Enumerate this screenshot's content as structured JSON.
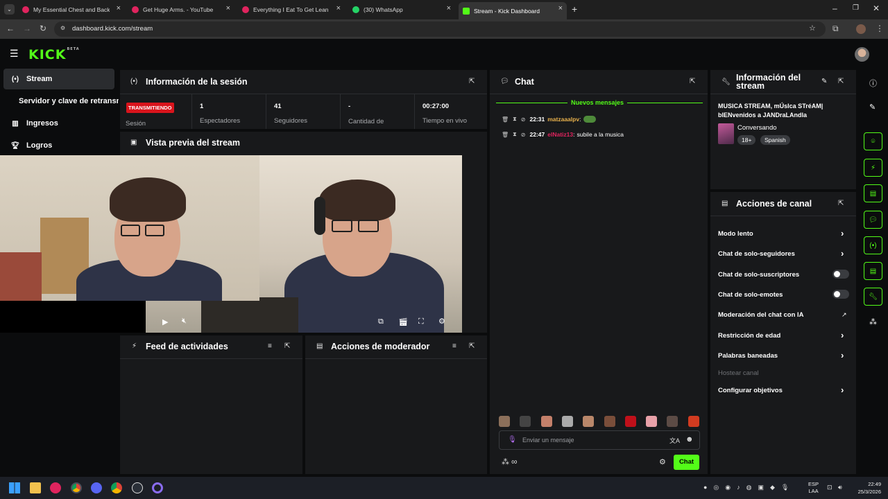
{
  "browser": {
    "tabs": [
      {
        "title": "My Essential Chest and Back W",
        "color": "#e0245e"
      },
      {
        "title": "Get Huge Arms. - YouTube",
        "color": "#e0245e"
      },
      {
        "title": "Everything I Eat To Get Lean In",
        "color": "#e0245e"
      },
      {
        "title": "(30) WhatsApp",
        "color": "#25d366"
      },
      {
        "title": "Stream - Kick Dashboard",
        "color": "#53fc18"
      }
    ],
    "url": "dashboard.kick.com/stream",
    "new_tab": "+"
  },
  "app": {
    "logo": "KICK",
    "logo_badge": "BETA"
  },
  "sidebar": {
    "items": [
      {
        "label": "Stream",
        "icon": "broadcast-icon"
      },
      {
        "label": "Servidor y clave de retransmisión",
        "icon": "key-icon"
      },
      {
        "label": "Ingresos",
        "icon": "chart-icon"
      },
      {
        "label": "Logros",
        "icon": "trophy-icon"
      }
    ]
  },
  "session": {
    "title": "Información de la sesión",
    "status_badge": "TRANSMITIENDO",
    "status_label": "Sesión",
    "stats": [
      {
        "value": "1",
        "label": "Espectadores"
      },
      {
        "value": "41",
        "label": "Seguidores"
      },
      {
        "value": "-",
        "label": "Cantidad de suscripciones"
      },
      {
        "value": "00:27:00",
        "label": "Tiempo en vivo"
      }
    ]
  },
  "preview": {
    "title": "Vista previa del stream"
  },
  "feed": {
    "title": "Feed de actividades"
  },
  "modactions": {
    "title": "Acciones de moderador"
  },
  "chat": {
    "title": "Chat",
    "new_messages": "Nuevos mensajes",
    "messages": [
      {
        "time": "22:31",
        "user": "matzaaalpv",
        "user_color": "#e9b24c",
        "text": ""
      },
      {
        "time": "22:47",
        "user": "elNatiz13",
        "user_color": "#e0245e",
        "text": "subile a la musica"
      }
    ],
    "input_placeholder": "Enviar un mensaje",
    "send_label": "Chat",
    "emote_colors": [
      "#8b6f5a",
      "#444",
      "#c4806a",
      "#aaa",
      "#b9876a",
      "#7a4e3a",
      "#c0101a",
      "#e8a0a8",
      "#5c4b45",
      "#d23b20"
    ]
  },
  "stream_info": {
    "title": "Información del stream",
    "stream_title": "MUSICA STREAM, mÚsIca STréAM| bIENvenidos a JANDraLAndla",
    "category": "Conversando",
    "tags": [
      "18+",
      "Spanish"
    ]
  },
  "channel_actions": {
    "title": "Acciones de canal",
    "rows": [
      {
        "label": "Modo lento",
        "control": "chevron"
      },
      {
        "label": "Chat de solo-seguidores",
        "control": "chevron"
      },
      {
        "label": "Chat de solo-suscriptores",
        "control": "toggle"
      },
      {
        "label": "Chat de solo-emotes",
        "control": "toggle"
      },
      {
        "label": "Moderación del chat con IA",
        "control": "external"
      },
      {
        "label": "Restricción de edad",
        "control": "chevron"
      },
      {
        "label": "Palabras baneadas",
        "control": "chevron"
      },
      {
        "label": "Hostear canal",
        "control": "none"
      },
      {
        "label": "Configurar objetivos",
        "control": "chevron"
      }
    ]
  },
  "taskbar": {
    "lang": "ESP",
    "lang2": "LAA",
    "time": "22:49",
    "date": "25/3/2026"
  }
}
